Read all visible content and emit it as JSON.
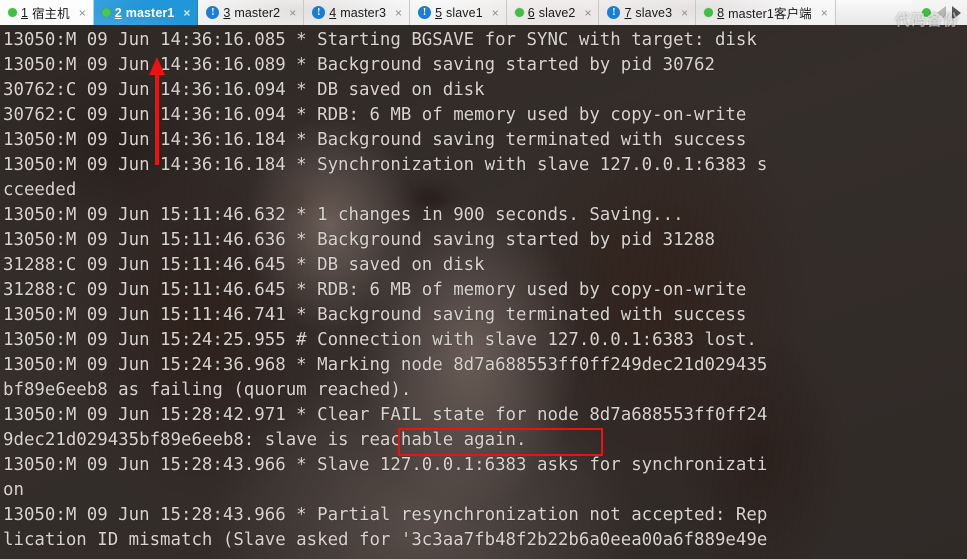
{
  "window": {
    "watermark": "代码备份"
  },
  "tabbar": {
    "tabs": [
      {
        "index": "1",
        "label": "宿主机",
        "status_icon": "green-dot-icon",
        "active": false,
        "close_label": "×"
      },
      {
        "index": "2",
        "label": "master1",
        "status_icon": "green-dot-icon",
        "active": true,
        "close_label": "×"
      },
      {
        "index": "3",
        "label": "master2",
        "status_icon": "blue-exclamation-icon",
        "active": false,
        "close_label": "×"
      },
      {
        "index": "4",
        "label": "master3",
        "status_icon": "blue-exclamation-icon",
        "active": false,
        "close_label": "×"
      },
      {
        "index": "5",
        "label": "slave1",
        "status_icon": "blue-exclamation-icon",
        "active": false,
        "close_label": "×"
      },
      {
        "index": "6",
        "label": "slave2",
        "status_icon": "green-dot-icon",
        "active": false,
        "close_label": "×"
      },
      {
        "index": "7",
        "label": "slave3",
        "status_icon": "blue-exclamation-icon",
        "active": false,
        "close_label": "×"
      },
      {
        "index": "8",
        "label": "master1客户端",
        "status_icon": "green-dot-icon",
        "active": false,
        "close_label": "×"
      }
    ],
    "overflow_indicator_icon": "green-dot-icon",
    "scroll_left_icon": "nav-arrow-left-icon",
    "scroll_right_icon": "nav-arrow-right-icon"
  },
  "terminal": {
    "lines": [
      "13050:M 09 Jun 14:36:16.085 * Starting BGSAVE for SYNC with target: disk",
      "13050:M 09 Jun 14:36:16.089 * Background saving started by pid 30762",
      "30762:C 09 Jun 14:36:16.094 * DB saved on disk",
      "30762:C 09 Jun 14:36:16.094 * RDB: 6 MB of memory used by copy-on-write",
      "13050:M 09 Jun 14:36:16.184 * Background saving terminated with success",
      "13050:M 09 Jun 14:36:16.184 * Synchronization with slave 127.0.0.1:6383 s",
      "cceeded",
      "13050:M 09 Jun 15:11:46.632 * 1 changes in 900 seconds. Saving...",
      "13050:M 09 Jun 15:11:46.636 * Background saving started by pid 31288",
      "31288:C 09 Jun 15:11:46.645 * DB saved on disk",
      "31288:C 09 Jun 15:11:46.645 * RDB: 6 MB of memory used by copy-on-write",
      "13050:M 09 Jun 15:11:46.741 * Background saving terminated with success",
      "13050:M 09 Jun 15:24:25.955 # Connection with slave 127.0.0.1:6383 lost.",
      "13050:M 09 Jun 15:24:36.968 * Marking node 8d7a688553ff0ff249dec21d029435",
      "bf89e6eeb8 as failing (quorum reached).",
      "13050:M 09 Jun 15:28:42.971 * Clear FAIL state for node 8d7a688553ff0ff24",
      "9dec21d029435bf89e6eeb8: slave is reachable again.",
      "13050:M 09 Jun 15:28:43.966 * Slave 127.0.0.1:6383 asks for synchronizati",
      "on",
      "13050:M 09 Jun 15:28:43.966 * Partial resynchronization not accepted: Rep",
      "lication ID mismatch (Slave asked for '3c3aa7fb48f2b22b6a0eea00a6f889e49e"
    ]
  },
  "annotations": {
    "arrow": {
      "label": "red-up-arrow",
      "color": "#ee1111"
    },
    "highlight_box": {
      "label": "Clear FAIL state",
      "color": "#ee1111"
    }
  },
  "colors": {
    "active_tab": "#2196d8",
    "status_ok": "#3ec13e",
    "status_warn": "#1a7fd4",
    "annotation_red": "#ee1111",
    "terminal_text": "#d9d4d0"
  }
}
